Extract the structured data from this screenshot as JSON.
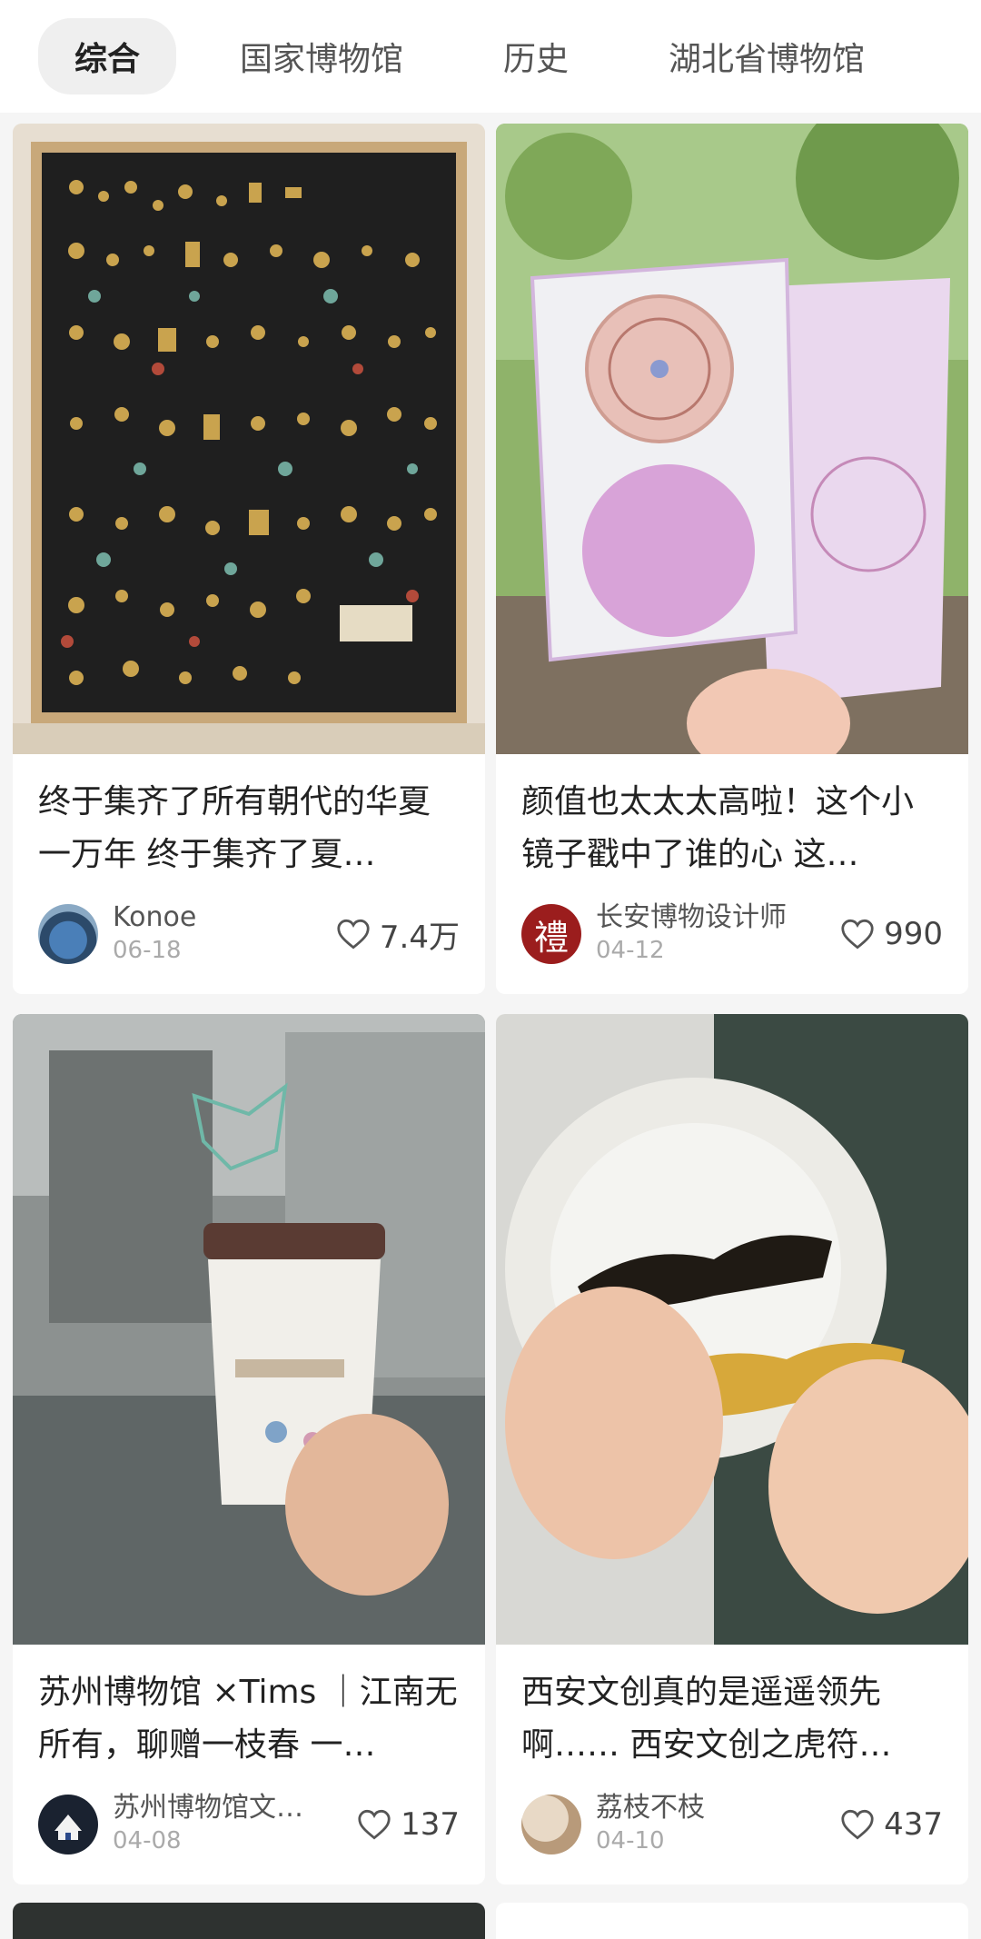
{
  "tabs": [
    {
      "label": "综合",
      "active": true
    },
    {
      "label": "国家博物馆",
      "active": false
    },
    {
      "label": "历史",
      "active": false
    },
    {
      "label": "湖北省博物馆",
      "active": false
    }
  ],
  "cards": [
    {
      "title": "终于集齐了所有朝代的华夏一万年 终于集齐了夏…",
      "author": "Konoe",
      "date": "06-18",
      "likes": "7.4万",
      "avatar_icon": "earth-avatar"
    },
    {
      "title": "颜值也太太太高啦！这个小镜子戳中了谁的心 这…",
      "author": "长安博物设计师",
      "date": "04-12",
      "likes": "990",
      "avatar_icon": "li-seal-avatar",
      "avatar_char": "禮"
    },
    {
      "title": "苏州博物馆 ×Tims ｜江南无所有，聊赠一枝春 一…",
      "author": "苏州博物馆文…",
      "date": "04-08",
      "likes": "137",
      "avatar_icon": "museum-avatar"
    },
    {
      "title": "西安文创真的是遥遥领先啊…… 西安文创之虎符…",
      "author": "荔枝不枝",
      "date": "04-10",
      "likes": "437",
      "avatar_icon": "photo-avatar"
    }
  ],
  "colors": {
    "background": "#f5f5f5",
    "card": "#ffffff",
    "active_tab_bg": "#efefef"
  }
}
